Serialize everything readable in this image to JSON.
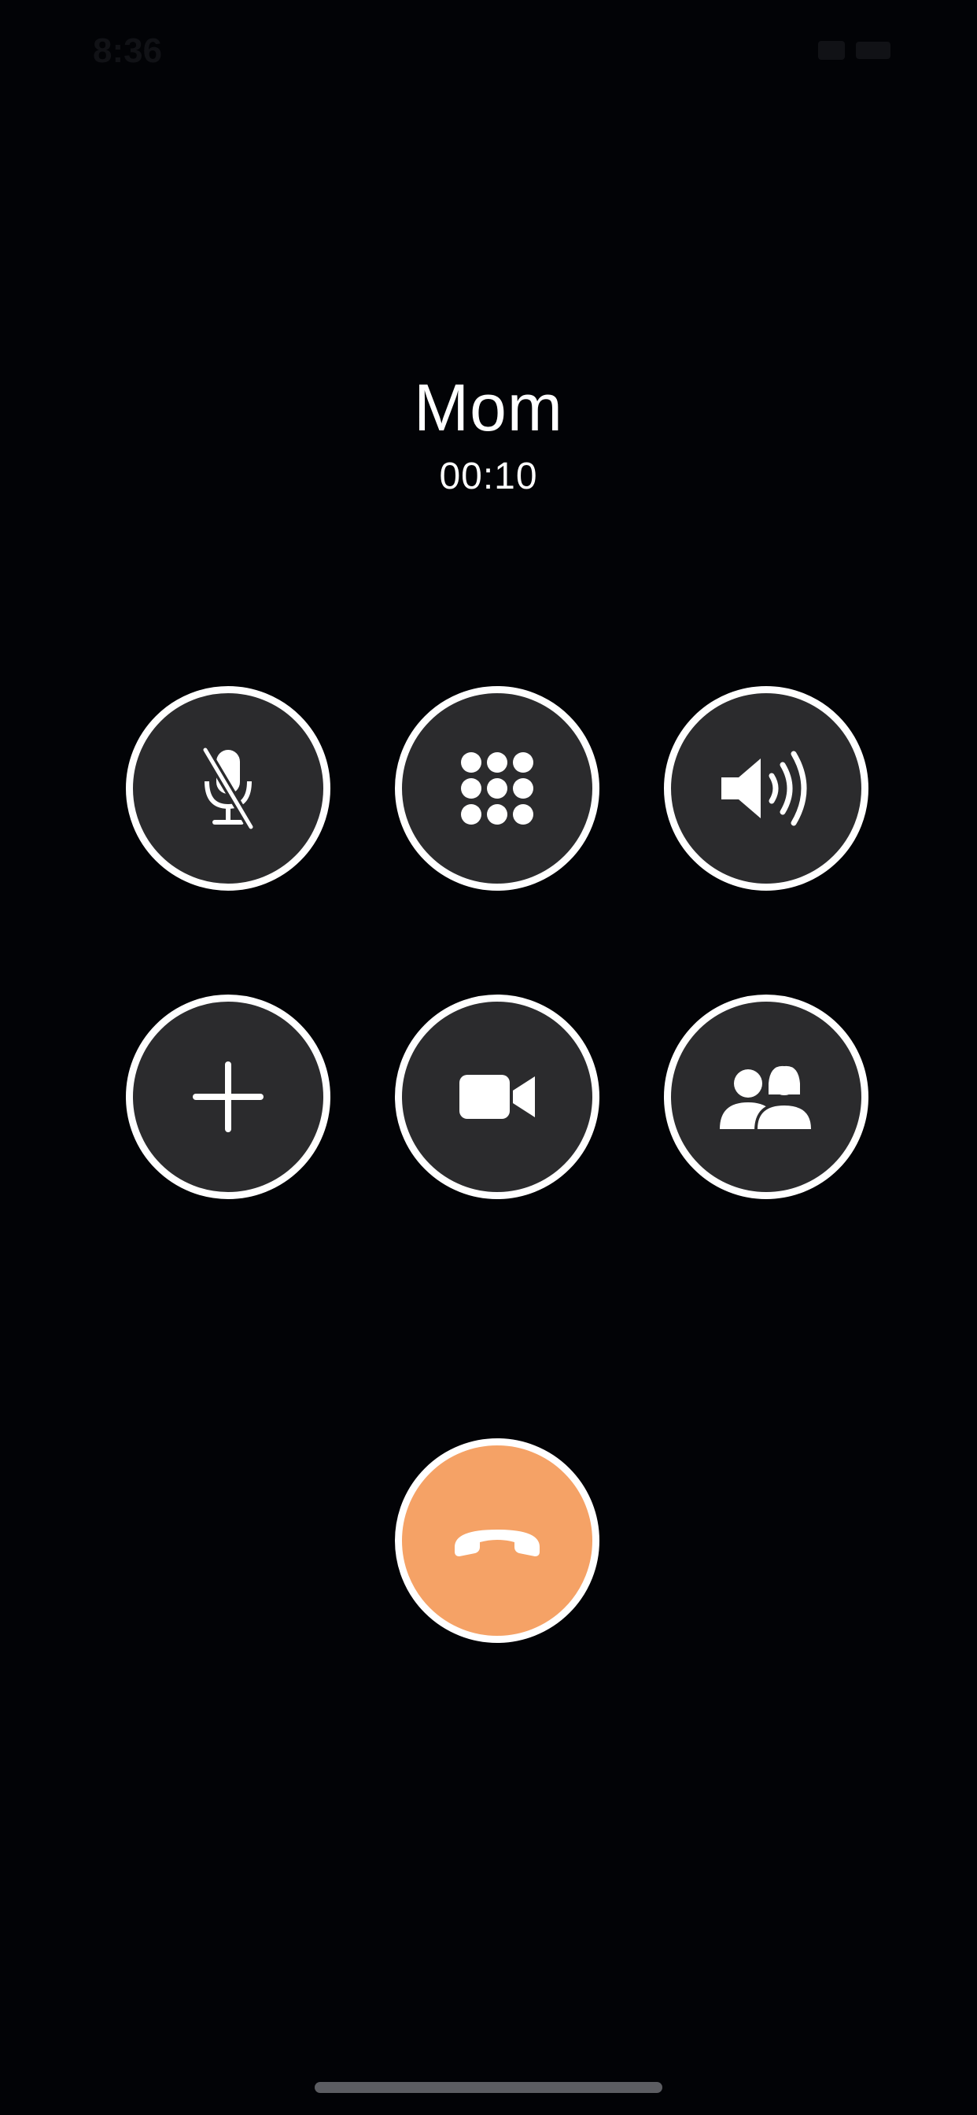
{
  "status_bar": {
    "time": "8:36",
    "icons": [
      "wifi-icon",
      "battery-icon"
    ]
  },
  "call": {
    "caller": "Mom",
    "duration": "00:10"
  },
  "controls": [
    {
      "name": "mute",
      "icon": "microphone-slash-icon"
    },
    {
      "name": "keypad",
      "icon": "keypad-icon"
    },
    {
      "name": "speaker",
      "icon": "speaker-icon"
    },
    {
      "name": "add-call",
      "icon": "plus-icon"
    },
    {
      "name": "facetime",
      "icon": "video-camera-icon"
    },
    {
      "name": "contacts",
      "icon": "contacts-icon"
    }
  ],
  "end_call": {
    "icon": "phone-hangup-icon"
  },
  "colors": {
    "background": "#020306",
    "button_fill": "#2b2b2d",
    "button_ring": "#ffffff",
    "end_call": "#f5a266"
  }
}
